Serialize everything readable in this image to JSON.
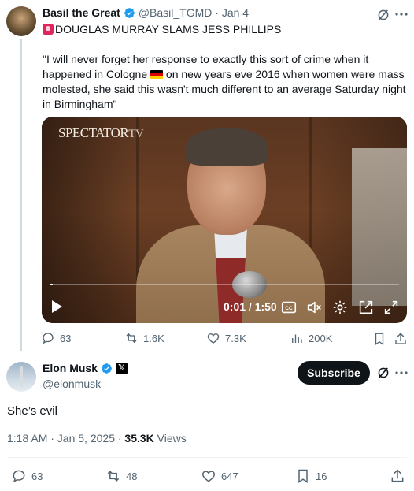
{
  "original_tweet": {
    "author_name": "Basil the Great",
    "handle_date": "@Basil_TGMD · Jan 4",
    "headline": "DOUGLAS MURRAY SLAMS JESS PHILLIPS",
    "quote_part1": "\"I will never forget her response to exactly this sort of crime when it happened in Cologne ",
    "quote_part2": " on new years eve 2016 when women were mass molested, she said this wasn't much different  to an average Saturday night in Birmingham\"",
    "video": {
      "brand": "SPECTATOR",
      "brand_tv": "TV",
      "time": "0:01 / 1:50",
      "progress": 0.01
    },
    "stats": {
      "replies": "63",
      "reposts": "1.6K",
      "likes": "7.3K",
      "views": "200K"
    }
  },
  "reply_tweet": {
    "author_name": "Elon Musk",
    "handle": "@elonmusk",
    "subscribe_label": "Subscribe",
    "text": "She’s evil",
    "timestamp": "1:18 AM · Jan 5, 2025 · ",
    "views_count": "35.3K",
    "views_label": " Views",
    "stats": {
      "replies": "63",
      "reposts": "48",
      "likes": "647",
      "bookmarks": "16"
    }
  },
  "colors": {
    "verified_blue": "#1d9bf0",
    "text_primary": "#0f1419",
    "text_secondary": "#536471"
  }
}
